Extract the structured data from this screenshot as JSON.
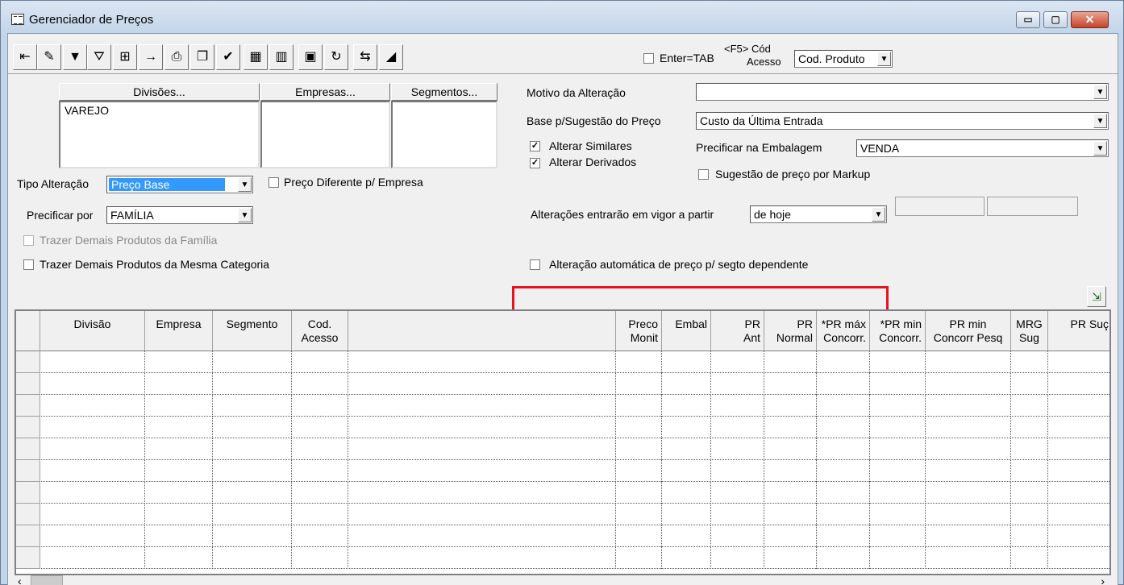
{
  "window": {
    "title": "Gerenciador de Preços",
    "minimize": "▭",
    "maximize": "▢",
    "close": "✕"
  },
  "toolbar": {
    "buttons": [
      {
        "icon": "exit-icon",
        "glyph": "⇤"
      },
      {
        "icon": "edit-icon",
        "glyph": "✎"
      },
      {
        "icon": "filter-icon",
        "glyph": "▼"
      },
      {
        "icon": "filter-check-icon",
        "glyph": "⛛"
      },
      {
        "icon": "add-icon",
        "glyph": "⊞"
      },
      {
        "icon": "export-icon",
        "glyph": "→"
      },
      {
        "icon": "print-icon",
        "glyph": "⎙"
      },
      {
        "icon": "copy-icon",
        "glyph": "❐"
      },
      {
        "icon": "check-list-icon",
        "glyph": "✔"
      },
      {
        "icon": "grid-edit-icon",
        "glyph": "▦"
      },
      {
        "icon": "columns-icon",
        "glyph": "▥"
      },
      {
        "icon": "save-icon",
        "glyph": "▣"
      },
      {
        "icon": "refresh-icon",
        "glyph": "↻"
      },
      {
        "icon": "transfer-icon",
        "glyph": "⇆"
      },
      {
        "icon": "chart-icon",
        "glyph": "◢"
      }
    ],
    "enter_tab_label": "Enter=TAB",
    "f5_label_line1": "<F5> Cód",
    "f5_label_line2": "Acesso",
    "cod_combo": "Cod. Produto"
  },
  "filters": {
    "divisoes_header": "Divisões...",
    "empresas_header": "Empresas...",
    "segmentos_header": "Segmentos...",
    "divisoes_items": [
      "VAREJO"
    ],
    "tipo_alteracao_label": "Tipo Alteração",
    "tipo_alteracao_value": "Preço Base",
    "preco_diferente_label": "Preço Diferente p/ Empresa",
    "precificar_por_label": "Precificar por",
    "precificar_por_value": "FAMÍLIA",
    "trazer_familia_label": "Trazer Demais Produtos da Família",
    "trazer_categoria_label": "Trazer Demais Produtos da Mesma Categoria"
  },
  "right": {
    "motivo_label": "Motivo da Alteração",
    "motivo_value": "",
    "base_label": "Base p/Sugestão do Preço",
    "base_value": "Custo da Última Entrada",
    "alterar_similares_label": "Alterar Similares",
    "alterar_similares_checked": true,
    "alterar_derivados_label": "Alterar Derivados",
    "alterar_derivados_checked": true,
    "embalagem_label": "Precificar na Embalagem",
    "embalagem_value": "VENDA",
    "markup_label": "Sugestão de preço por Markup",
    "vigor_label": "Alterações entrarão em vigor a partir",
    "vigor_value": "de hoje",
    "auto_label": "Alteração automática de preço p/ segto dependente",
    "check_glyph": "✓",
    "arrow_glyph": "▼"
  },
  "grid": {
    "columns": [
      {
        "l1": "Divisão",
        "l2": ""
      },
      {
        "l1": "Empresa",
        "l2": ""
      },
      {
        "l1": "Segmento",
        "l2": ""
      },
      {
        "l1": "Cod.",
        "l2": "Acesso"
      },
      {
        "l1": "",
        "l2": ""
      },
      {
        "l1": "Preco",
        "l2": "Monit"
      },
      {
        "l1": "Embal",
        "l2": ""
      },
      {
        "l1": "PR",
        "l2": "Ant"
      },
      {
        "l1": "PR",
        "l2": "Normal"
      },
      {
        "l1": "*PR máx",
        "l2": "Concorr."
      },
      {
        "l1": "*PR min",
        "l2": "Concorr."
      },
      {
        "l1": "PR min",
        "l2": "Concorr Pesq"
      },
      {
        "l1": "MRG",
        "l2": "Sug"
      },
      {
        "l1": "PR Suç",
        "l2": ""
      }
    ],
    "corner_icon": "export-grid-icon",
    "corner_glyph": "⇲",
    "scroll_left": "‹",
    "scroll_right": "›"
  }
}
